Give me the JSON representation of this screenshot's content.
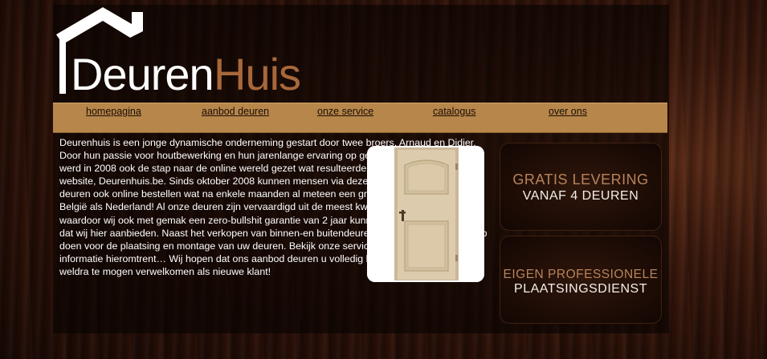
{
  "logo": {
    "text_part1": "Deuren",
    "text_part2": "Huis"
  },
  "nav": {
    "items": [
      {
        "label": "homepagina"
      },
      {
        "label": "aanbod deuren"
      },
      {
        "label": "onze service"
      },
      {
        "label": "catalogus"
      },
      {
        "label": "over ons"
      }
    ]
  },
  "intro": {
    "text": "Deurenhuis is een jonge dynamische onderneming gestart door twee broers, Arnaud en Didier. Door hun passie voor houtbewerking en hun jarenlange ervaring op gebied van deurenplaatsing werd in 2008 ook de stap naar de online wereld gezet wat resulteerde in de geboorte van deze website, Deurenhuis.be. Sinds oktober 2008 kunnen mensen via deze website onze kwalitatieve deuren ook online bestellen wat na enkele maanden al meteen een groot succes werd in zowel België als Nederland! Al onze deuren zijn vervaardigd uit de meest kwalitatieve materialen waardoor wij ook met gemak een zero-bullshit garantie van 2 jaar kunnen bieden op iedere deur dat wij hier aanbieden. Naast het verkopen van binnen-en buitendeuren kan u op ons ook beroep doen voor de plaatsing en montage van uw deuren. Bekijk onze service-pagina voor meer informatie hieromtrent… Wij hopen dat ons aanbod deuren u volledig kan bekoren en hopen u weldra te mogen verwelkomen als nieuwe klant!"
  },
  "promos": [
    {
      "line1": "GRATIS LEVERING",
      "line2": "VANAF 4 DEUREN"
    },
    {
      "line1": "EIGEN PROFESSIONELE",
      "line2": "PLAATSINGSDIENST"
    }
  ],
  "colors": {
    "nav_bg": "#b7864a",
    "logo_accent": "#a8683a",
    "promo_accent": "#b8835b",
    "text": "#ffffff"
  }
}
